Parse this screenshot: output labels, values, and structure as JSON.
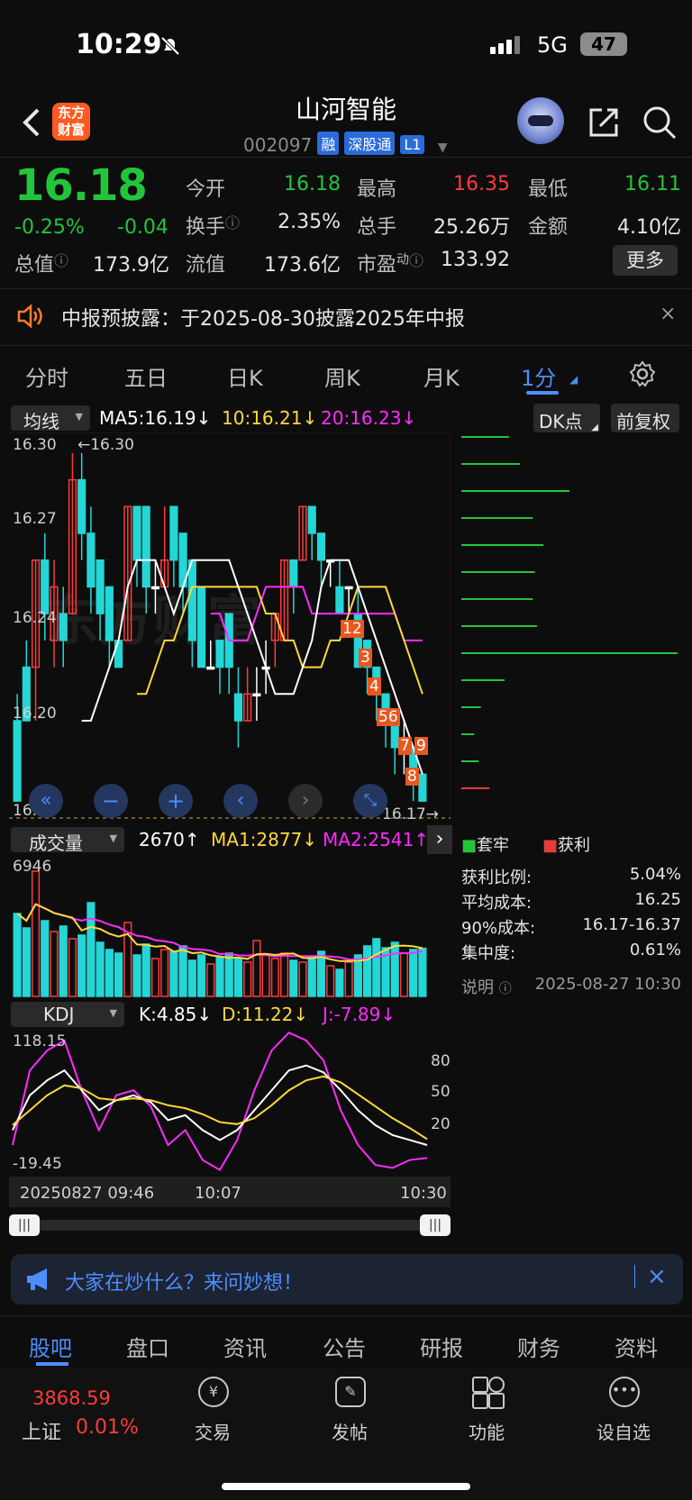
{
  "status": {
    "time": "10:29",
    "network": "5G",
    "battery": "47"
  },
  "header": {
    "back_icon": "chevron-left-icon",
    "logo_line1": "东方",
    "logo_line2": "财富",
    "stock_name": "山河智能",
    "stock_code": "002097",
    "tags": [
      "融",
      "深股通",
      "L1"
    ],
    "share_icon": "share-icon",
    "search_icon": "search-icon"
  },
  "quote": {
    "price": "16.18",
    "change_pct": "-0.25%",
    "change": "-0.04",
    "fields": {
      "open_label": "今开",
      "open": "16.18",
      "high_label": "最高",
      "high": "16.35",
      "low_label": "最低",
      "low": "16.11",
      "turnover_label": "换手",
      "turnover": "2.35%",
      "volume_label": "总手",
      "volume": "25.26万",
      "amount_label": "金额",
      "amount": "4.10亿",
      "mktcap_label": "总值",
      "mktcap": "173.9亿",
      "float_label": "流值",
      "float": "173.6亿",
      "pe_label": "市盈",
      "pe_sup": "动",
      "pe": "133.92"
    },
    "more_label": "更多"
  },
  "notice": {
    "text": "中报预披露：于2025-08-30披露2025年中报",
    "close": "×"
  },
  "period_tabs": [
    "分时",
    "五日",
    "日K",
    "周K",
    "月K",
    "1分"
  ],
  "settings_icon": "gear-icon",
  "ma_row": {
    "select": "均线",
    "ma5": "MA5:16.19↓",
    "ma10": "10:16.21↓",
    "ma20": "20:16.23↓",
    "dk": "DK点",
    "adjust": "前复权"
  },
  "price_axis": {
    "top": "16.30",
    "l2": "16.27",
    "l3": "16.24",
    "l4": "16.20",
    "bottom": "16.17"
  },
  "max_label": "←16.30",
  "last_label": "16.17→",
  "counters": [
    "12",
    "3",
    "4",
    "56",
    "7",
    "9",
    "8"
  ],
  "vol_row": {
    "select": "成交量",
    "vol": "2670↑",
    "ma1": "MA1:2877↓",
    "ma2": "MA2:2541↑",
    "axis_max": "6946"
  },
  "kdj_row": {
    "select": "KDJ",
    "k": "K:4.85↓",
    "d": "D:11.22↓",
    "j": "J:-7.89↓",
    "axis_max": "118.15",
    "axis_min": "-19.45",
    "l80": "80",
    "l50": "50",
    "l20": "20"
  },
  "time_axis": {
    "start": "20250827 09:46",
    "mid": "10:07",
    "end": "10:30"
  },
  "chip": {
    "legend_trap": "套牢",
    "legend_profit": "获利",
    "rows": [
      {
        "label": "获利比例:",
        "value": "5.04%"
      },
      {
        "label": "平均成本:",
        "value": "16.25"
      },
      {
        "label": "90%成本:",
        "value": "16.17-16.37"
      },
      {
        "label": "集中度:",
        "value": "0.61%"
      }
    ],
    "note_label": "说明",
    "note_time": "2025-08-27 10:30",
    "bars": [
      0.22,
      0.27,
      0.5,
      0.33,
      0.38,
      0.34,
      0.33,
      0.35,
      1.0,
      0.2,
      0.09,
      0.06,
      0.08,
      0.13
    ],
    "colors": {
      "trap": "#22c53a",
      "profit": "#e23c3c"
    }
  },
  "ask": {
    "text": "大家在炒什么？来问妙想！",
    "icon": "megaphone-icon",
    "close": "×"
  },
  "bottom_tabs": [
    "股吧",
    "盘口",
    "资讯",
    "公告",
    "研报",
    "财务",
    "资料"
  ],
  "bottom_nav": {
    "index_value": "3868.59",
    "index_name": "上证",
    "index_change": "0.01%",
    "items": [
      "交易",
      "发帖",
      "功能",
      "设自选"
    ]
  },
  "chart_data": {
    "type": "candlestick",
    "ylim": [
      16.17,
      16.3
    ],
    "candles": [
      {
        "o": 16.2,
        "c": 16.17,
        "h": 16.21,
        "l": 16.17
      },
      {
        "o": 16.22,
        "c": 16.2,
        "h": 16.23,
        "l": 16.2
      },
      {
        "o": 16.22,
        "c": 16.26,
        "h": 16.26,
        "l": 16.2
      },
      {
        "o": 16.26,
        "c": 16.24,
        "h": 16.27,
        "l": 16.23
      },
      {
        "o": 16.23,
        "c": 16.25,
        "h": 16.26,
        "l": 16.22
      },
      {
        "o": 16.24,
        "c": 16.23,
        "h": 16.25,
        "l": 16.22
      },
      {
        "o": 16.24,
        "c": 16.29,
        "h": 16.3,
        "l": 16.24
      },
      {
        "o": 16.29,
        "c": 16.27,
        "h": 16.3,
        "l": 16.26
      },
      {
        "o": 16.27,
        "c": 16.25,
        "h": 16.28,
        "l": 16.24
      },
      {
        "o": 16.26,
        "c": 16.24,
        "h": 16.26,
        "l": 16.23
      },
      {
        "o": 16.25,
        "c": 16.23,
        "h": 16.25,
        "l": 16.22
      },
      {
        "o": 16.23,
        "c": 16.22,
        "h": 16.23,
        "l": 16.22
      },
      {
        "o": 16.23,
        "c": 16.28,
        "h": 16.28,
        "l": 16.23
      },
      {
        "o": 16.28,
        "c": 16.26,
        "h": 16.28,
        "l": 16.25
      },
      {
        "o": 16.28,
        "c": 16.25,
        "h": 16.28,
        "l": 16.24
      },
      {
        "o": 16.25,
        "c": 16.25,
        "h": 16.26,
        "l": 16.24
      },
      {
        "o": 16.25,
        "c": 16.26,
        "h": 16.28,
        "l": 16.25
      },
      {
        "o": 16.28,
        "c": 16.26,
        "h": 16.28,
        "l": 16.25
      },
      {
        "o": 16.27,
        "c": 16.25,
        "h": 16.27,
        "l": 16.24
      },
      {
        "o": 16.26,
        "c": 16.23,
        "h": 16.26,
        "l": 16.22
      },
      {
        "o": 16.25,
        "c": 16.22,
        "h": 16.25,
        "l": 16.22
      },
      {
        "o": 16.22,
        "c": 16.22,
        "h": 16.23,
        "l": 16.22
      },
      {
        "o": 16.23,
        "c": 16.22,
        "h": 16.23,
        "l": 16.21
      },
      {
        "o": 16.24,
        "c": 16.22,
        "h": 16.24,
        "l": 16.21
      },
      {
        "o": 16.21,
        "c": 16.2,
        "h": 16.22,
        "l": 16.19
      },
      {
        "o": 16.2,
        "c": 16.21,
        "h": 16.22,
        "l": 16.2
      },
      {
        "o": 16.21,
        "c": 16.21,
        "h": 16.22,
        "l": 16.2
      },
      {
        "o": 16.22,
        "c": 16.22,
        "h": 16.23,
        "l": 16.21
      },
      {
        "o": 16.23,
        "c": 16.24,
        "h": 16.24,
        "l": 16.22
      },
      {
        "o": 16.23,
        "c": 16.26,
        "h": 16.26,
        "l": 16.23
      },
      {
        "o": 16.26,
        "c": 16.25,
        "h": 16.26,
        "l": 16.24
      },
      {
        "o": 16.26,
        "c": 16.28,
        "h": 16.28,
        "l": 16.26
      },
      {
        "o": 16.28,
        "c": 16.27,
        "h": 16.28,
        "l": 16.26
      },
      {
        "o": 16.27,
        "c": 16.26,
        "h": 16.27,
        "l": 16.25
      },
      {
        "o": 16.26,
        "c": 16.26,
        "h": 16.26,
        "l": 16.25
      },
      {
        "o": 16.25,
        "c": 16.24,
        "h": 16.26,
        "l": 16.24
      },
      {
        "o": 16.25,
        "c": 16.25,
        "h": 16.25,
        "l": 16.24
      },
      {
        "o": 16.24,
        "c": 16.22,
        "h": 16.25,
        "l": 16.22
      },
      {
        "o": 16.23,
        "c": 16.22,
        "h": 16.23,
        "l": 16.21
      },
      {
        "o": 16.22,
        "c": 16.21,
        "h": 16.22,
        "l": 16.2
      },
      {
        "o": 16.21,
        "c": 16.2,
        "h": 16.21,
        "l": 16.19
      },
      {
        "o": 16.2,
        "c": 16.19,
        "h": 16.2,
        "l": 16.18
      },
      {
        "o": 16.19,
        "c": 16.19,
        "h": 16.2,
        "l": 16.18
      },
      {
        "o": 16.19,
        "c": 16.18,
        "h": 16.19,
        "l": 16.17
      },
      {
        "o": 16.18,
        "c": 16.17,
        "h": 16.18,
        "l": 16.17
      }
    ],
    "ma5": [
      16.2,
      16.2,
      16.21,
      16.22,
      16.23,
      16.25,
      16.26,
      16.26,
      16.26,
      16.25,
      16.24,
      16.25,
      16.26,
      16.26,
      16.26,
      16.26,
      16.26,
      16.25,
      16.24,
      16.23,
      16.22,
      16.21,
      16.21,
      16.21,
      16.22,
      16.23,
      16.25,
      16.26,
      16.26,
      16.26,
      16.25,
      16.24,
      16.23,
      16.22,
      16.21,
      16.2,
      16.19,
      16.18
    ],
    "ma10": [
      16.21,
      16.21,
      16.22,
      16.23,
      16.23,
      16.24,
      16.25,
      16.25,
      16.25,
      16.25,
      16.25,
      16.25,
      16.25,
      16.25,
      16.24,
      16.24,
      16.23,
      16.23,
      16.22,
      16.22,
      16.22,
      16.23,
      16.23,
      16.24,
      16.25,
      16.25,
      16.25,
      16.25,
      16.24,
      16.23,
      16.22,
      16.21
    ],
    "ma20": [
      16.24,
      16.24,
      16.23,
      16.23,
      16.23,
      16.24,
      16.25,
      16.25,
      16.25,
      16.25,
      16.25,
      16.24,
      16.24,
      16.24,
      16.24,
      16.24,
      16.24,
      16.24,
      16.24,
      16.24,
      16.24,
      16.23,
      16.23,
      16.23
    ],
    "volumes": [
      4600,
      3800,
      6946,
      4200,
      3600,
      3900,
      3200,
      3400,
      5200,
      3000,
      2600,
      2400,
      4100,
      2300,
      2900,
      2100,
      2600,
      2500,
      2800,
      2000,
      2300,
      1800,
      2200,
      2400,
      2100,
      1900,
      3100,
      2300,
      2100,
      2400,
      2000,
      1900,
      2200,
      2500,
      1700,
      1500,
      1900,
      2300,
      2800,
      3200,
      2700,
      3000,
      2400,
      2600,
      2670
    ],
    "kdj": {
      "k": [
        20,
        55,
        70,
        80,
        60,
        40,
        50,
        55,
        48,
        30,
        35,
        20,
        10,
        20,
        40,
        60,
        80,
        85,
        78,
        60,
        40,
        25,
        15,
        10,
        5
      ],
      "d": [
        25,
        40,
        55,
        65,
        62,
        52,
        50,
        52,
        50,
        45,
        42,
        36,
        28,
        26,
        32,
        45,
        60,
        70,
        74,
        68,
        56,
        44,
        32,
        22,
        11
      ],
      "j": [
        5,
        80,
        100,
        110,
        60,
        20,
        55,
        60,
        44,
        5,
        20,
        -10,
        -20,
        10,
        60,
        100,
        118,
        110,
        90,
        40,
        5,
        -15,
        -18,
        -10,
        -8
      ]
    }
  }
}
